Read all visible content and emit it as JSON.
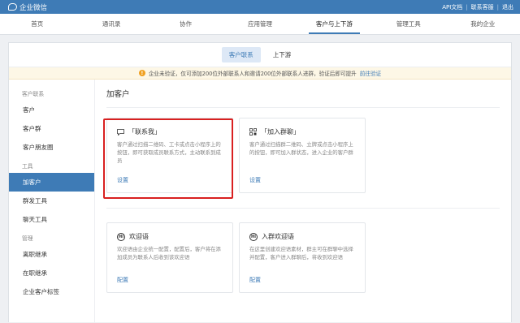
{
  "topbar": {
    "app_name": "企业微信",
    "links": [
      "API文档",
      "联系客服",
      "退出"
    ],
    "separator": "|"
  },
  "nav": {
    "items": [
      "首页",
      "通讯录",
      "协作",
      "应用管理",
      "客户与上下游",
      "管理工具",
      "我的企业"
    ],
    "active_index": 4
  },
  "subtabs": {
    "items": [
      "客户联系",
      "上下游"
    ],
    "active_index": 0
  },
  "notice": {
    "icon": "!",
    "text": "企业未验证，仅可添加200位外部联系人和邀请200位外部联系人进群，验证后即可提升",
    "link": "前往验证"
  },
  "sidebar": {
    "section1": "客户联系",
    "items1": [
      "客户",
      "客户群",
      "客户朋友圈"
    ],
    "section2": "工具",
    "items2": [
      "加客户",
      "群发工具",
      "聊天工具"
    ],
    "section3": "管理",
    "items3": [
      "离职继承",
      "在职继承",
      "企业客户标签"
    ],
    "active": "加客户"
  },
  "main": {
    "title": "加客户",
    "cards": [
      {
        "title": "「联系我」",
        "icon": "chat-bubble-icon",
        "desc": "客户通过扫描二维码、工卡或点击小程序上的按钮，即可获取成员联系方式，主动联系到成员",
        "action": "设置"
      },
      {
        "title": "「加入群聊」",
        "icon": "qrcode-icon",
        "desc": "客户通过扫描群二维码、立牌或点击小程序上的按钮，即可加入群状态，进入企业的客户群",
        "action": "设置"
      },
      {
        "title": "欢迎语",
        "icon": "hi-icon",
        "icon_text": "Hi",
        "desc": "欢迎语由企业统一配置，配置后，客户将在添加成员为联系人后收到该欢迎语",
        "action": "配置"
      },
      {
        "title": "入群欢迎语",
        "icon": "hi-icon",
        "icon_text": "Hi",
        "desc": "在这里创建欢迎语素材，群主可在群聊中选择并配置，客户进入群聊后，将收到欢迎语",
        "action": "配置"
      }
    ]
  },
  "colors": {
    "accent": "#3e7bb6",
    "highlight": "#d92020",
    "notice_bg": "#fdf7e6",
    "warn": "#f0a020"
  }
}
